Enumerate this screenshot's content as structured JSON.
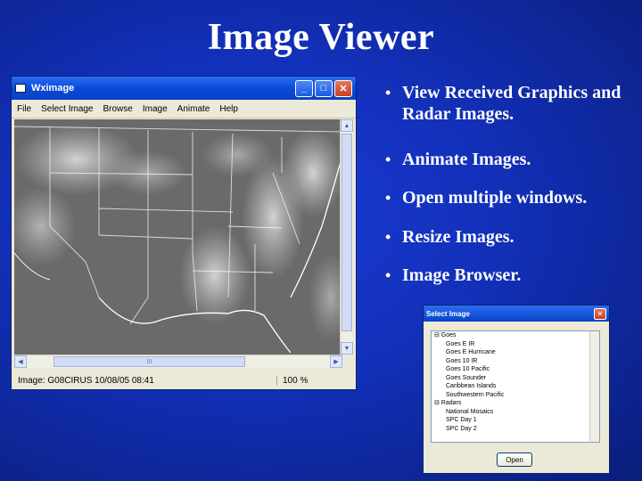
{
  "slide": {
    "title": "Image Viewer"
  },
  "bullets": [
    "View Received Graphics and Radar Images.",
    "Animate Images.",
    "Open multiple windows.",
    "Resize Images.",
    "Image Browser."
  ],
  "bullet_glyph": "•",
  "main_window": {
    "title": "Wximage",
    "buttons": {
      "minimize": "_",
      "maximize": "□",
      "close": "✕"
    },
    "menu": [
      "File",
      "Select Image",
      "Browse",
      "Image",
      "Animate",
      "Help"
    ],
    "status": {
      "info": "Image: G08CIRUS  10/08/05 08:41",
      "zoom": "100 %"
    },
    "scroll_glyphs": {
      "up": "▲",
      "down": "▼",
      "left": "◀",
      "right": "▶",
      "grip": "III"
    }
  },
  "dialog": {
    "title": "Select Image",
    "close": "✕",
    "tree": [
      {
        "level": 0,
        "label": "⊟ Goes"
      },
      {
        "level": 1,
        "label": "Goes E IR"
      },
      {
        "level": 1,
        "label": "Goes E Hurricane"
      },
      {
        "level": 1,
        "label": "Goes 10 IR"
      },
      {
        "level": 1,
        "label": "Goes 10 Pacific"
      },
      {
        "level": 1,
        "label": "Goes Sounder"
      },
      {
        "level": 1,
        "label": "Caribbean Islands"
      },
      {
        "level": 1,
        "label": "Southwestern Pacific"
      },
      {
        "level": 0,
        "label": "⊟ Radars"
      },
      {
        "level": 1,
        "label": "National Mosaics"
      },
      {
        "level": 1,
        "label": "SPC Day 1"
      },
      {
        "level": 1,
        "label": "SPC Day 2"
      }
    ],
    "ok_label": "Open"
  },
  "colors": {
    "background": "#1230b8",
    "titlebar": "#0a4ad8",
    "window": "#ece9d8"
  }
}
